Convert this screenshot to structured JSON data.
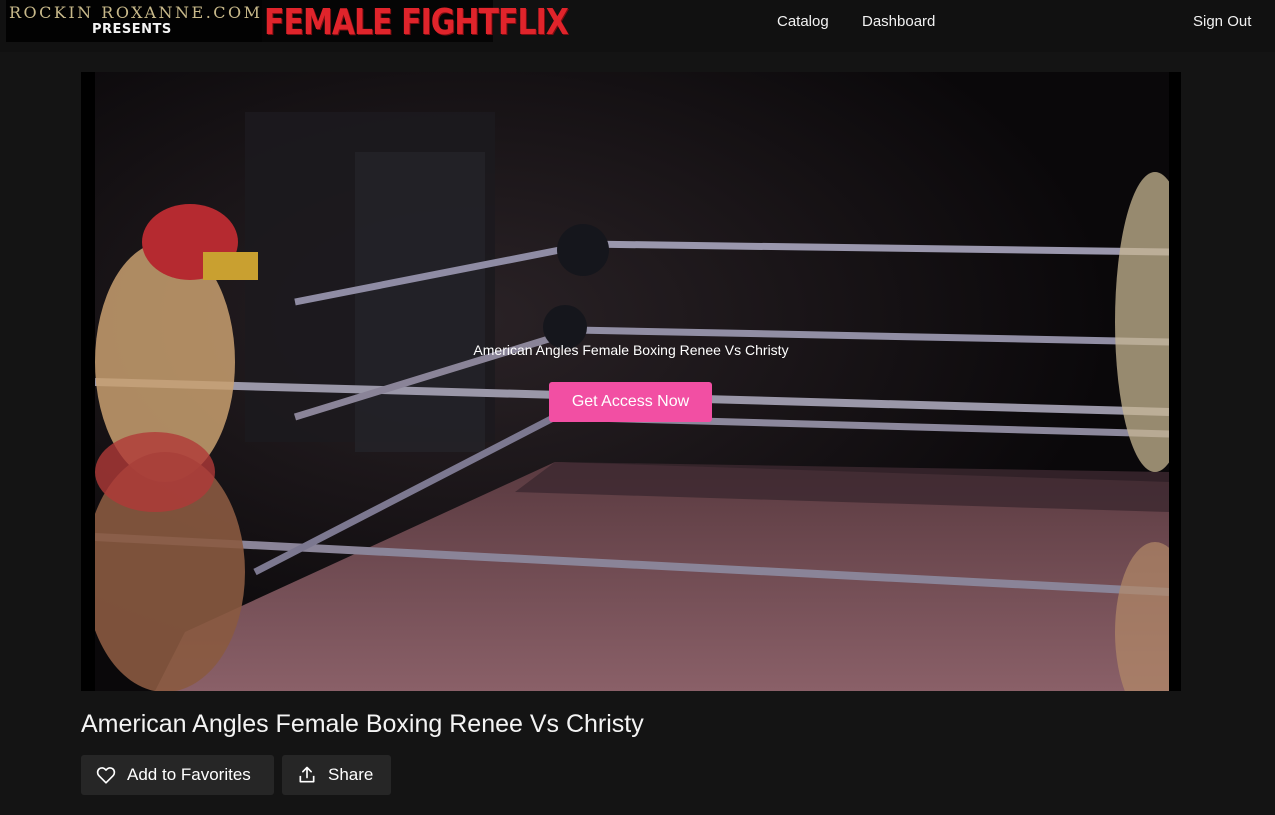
{
  "header": {
    "logo": {
      "line1": "ROCKIN ROXANNE.COM",
      "line2": "PRESENTS",
      "brand": "FEMALE FIGHTFLIX"
    },
    "nav": {
      "catalog": "Catalog",
      "dashboard": "Dashboard",
      "sign_out": "Sign Out"
    }
  },
  "player": {
    "overlay_title": "American Angles Female Boxing Renee Vs Christy",
    "cta_label": "Get Access Now"
  },
  "video": {
    "title": "American Angles Female Boxing Renee Vs Christy",
    "actions": {
      "favorite_label": "Add to Favorites",
      "favorite_icon": "heart-icon",
      "share_label": "Share",
      "share_icon": "share-icon"
    }
  },
  "colors": {
    "background": "#141414",
    "accent": "#f24fa3",
    "brand_red": "#e0242b",
    "button_bg": "#262626"
  }
}
